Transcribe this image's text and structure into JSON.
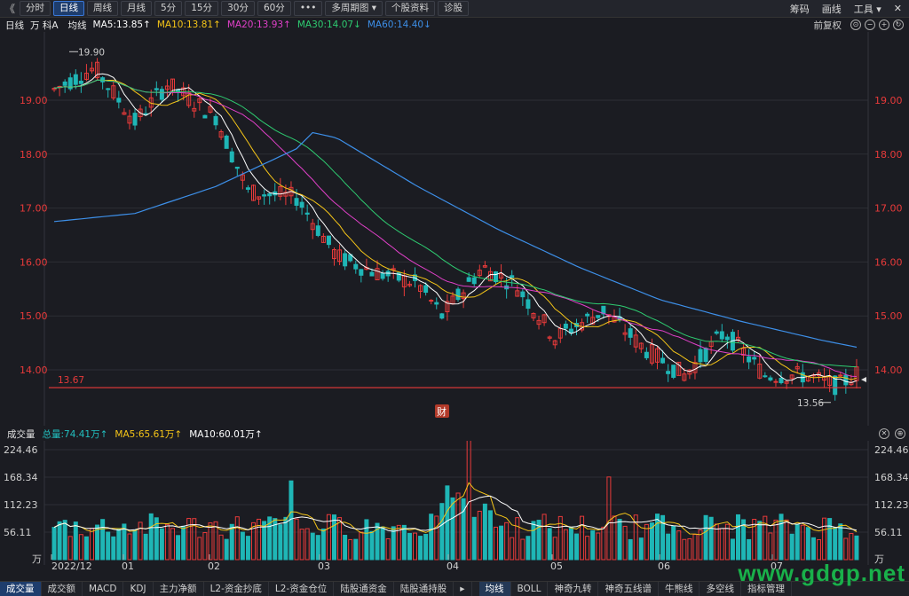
{
  "toolbar": {
    "back": "《",
    "tabs": [
      {
        "label": "分时",
        "active": false
      },
      {
        "label": "日线",
        "active": true
      },
      {
        "label": "周线",
        "active": false
      },
      {
        "label": "月线",
        "active": false
      },
      {
        "label": "5分",
        "active": false
      },
      {
        "label": "15分",
        "active": false
      },
      {
        "label": "30分",
        "active": false
      },
      {
        "label": "60分",
        "active": false
      },
      {
        "label": "•••",
        "active": false
      },
      {
        "label": "多周期图 ▾",
        "active": false
      },
      {
        "label": "个股资料",
        "active": false
      },
      {
        "label": "诊股",
        "active": false
      }
    ],
    "right": [
      "筹码",
      "画线",
      "工具 ▾"
    ],
    "close": "✕"
  },
  "main_bar": {
    "period": "日线",
    "stock": "万 科A",
    "line_type": "均线",
    "ma": [
      {
        "text": "MA5:13.85↑",
        "color": "#ffffff"
      },
      {
        "text": "MA10:13.81↑",
        "color": "#f5c518"
      },
      {
        "text": "MA20:13.93↑",
        "color": "#e040c8"
      },
      {
        "text": "MA30:14.07↓",
        "color": "#2ecc71"
      },
      {
        "text": "MA60:14.40↓",
        "color": "#3d8fe8"
      }
    ],
    "adjust": "前复权",
    "controls": [
      "⊙",
      "−",
      "+",
      "↻"
    ]
  },
  "volume_bar": {
    "label": "成交量",
    "items": [
      {
        "text": "总量:74.41万↑",
        "color": "#22c0c0"
      },
      {
        "text": "MA5:65.61万↑",
        "color": "#f5c518"
      },
      {
        "text": "MA10:60.01万↑",
        "color": "#ffffff"
      }
    ],
    "controls": [
      "✕",
      "⊕"
    ]
  },
  "colors": {
    "up": "#e83a3a",
    "down": "#1fb6b6",
    "bg": "#1b1c22",
    "grid": "#2c2e35"
  },
  "price_chart": {
    "y_ticks": [
      "19.00",
      "18.00",
      "17.00",
      "16.00",
      "15.00",
      "14.00"
    ],
    "high_label": "19.90",
    "low_label": "13.56",
    "support_label": "13.67",
    "marker": "财"
  },
  "volume_chart": {
    "y_ticks": [
      "224.46",
      "168.34",
      "112.23",
      "56.11"
    ],
    "unit": "万"
  },
  "x_labels": [
    "2022/12",
    "01",
    "02",
    "03",
    "04",
    "05",
    "06",
    "07"
  ],
  "bottom_tabs": [
    {
      "label": "成交量",
      "active": true
    },
    {
      "label": "成交额",
      "active": false
    },
    {
      "label": "MACD",
      "active": false
    },
    {
      "label": "KDJ",
      "active": false
    },
    {
      "label": "主力净额",
      "active": false
    },
    {
      "label": "L2-资金抄底",
      "active": false
    },
    {
      "label": "L2-资金仓位",
      "active": false
    },
    {
      "label": "陆股通资金",
      "active": false
    },
    {
      "label": "陆股通持股",
      "active": false
    },
    {
      "label": "▸",
      "active": false
    },
    {
      "label": "均线",
      "active": true
    },
    {
      "label": "BOLL",
      "active": false
    },
    {
      "label": "神奇九转",
      "active": false
    },
    {
      "label": "神奇五线谱",
      "active": false
    },
    {
      "label": "牛熊线",
      "active": false
    },
    {
      "label": "多空线",
      "active": false
    },
    {
      "label": "指标管理",
      "active": false
    }
  ],
  "watermark": "www.gdgp.net"
}
